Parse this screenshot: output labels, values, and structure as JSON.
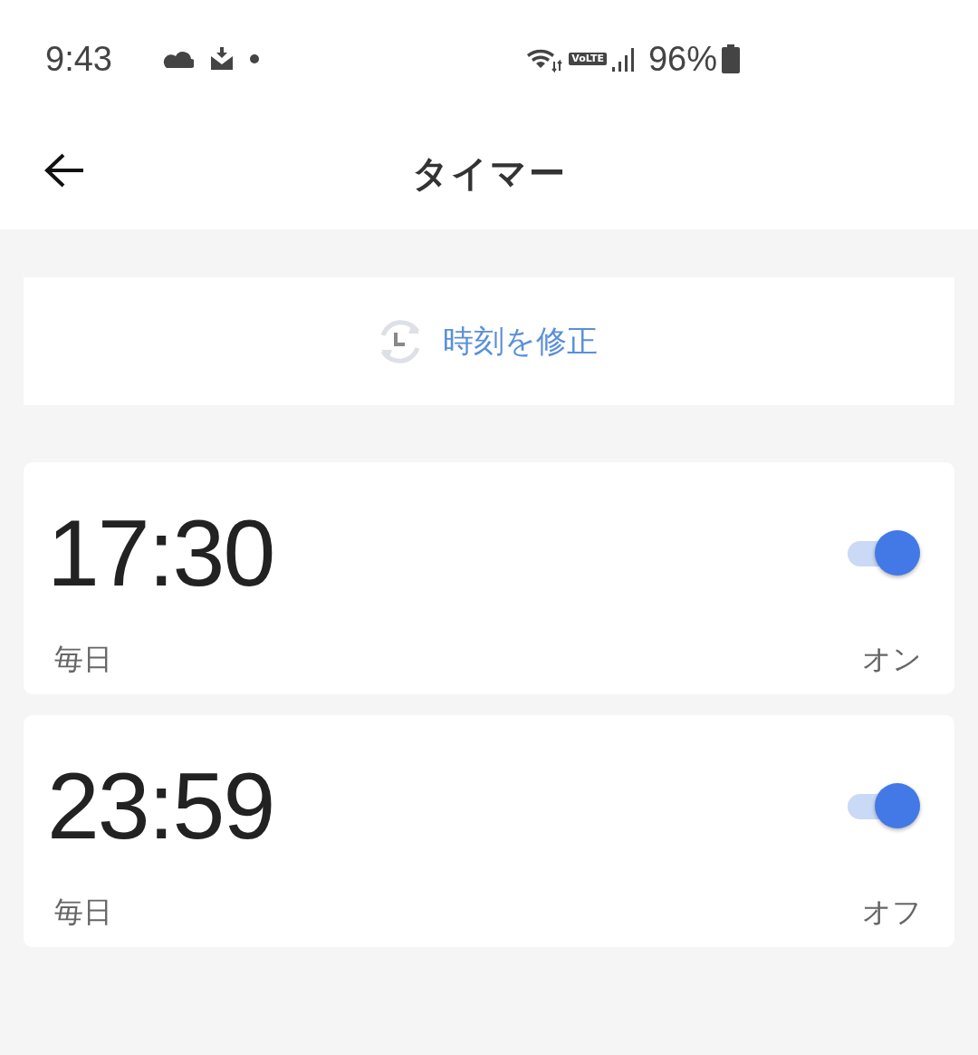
{
  "status_bar": {
    "time": "9:43",
    "network_badge": "VoLTE",
    "battery": "96%"
  },
  "header": {
    "title": "タイマー"
  },
  "sync_button": {
    "label": "時刻を修正"
  },
  "timers": [
    {
      "time": "17:30",
      "repeat": "毎日",
      "action": "オン",
      "on": true
    },
    {
      "time": "23:59",
      "repeat": "毎日",
      "action": "オフ",
      "on": true
    }
  ]
}
